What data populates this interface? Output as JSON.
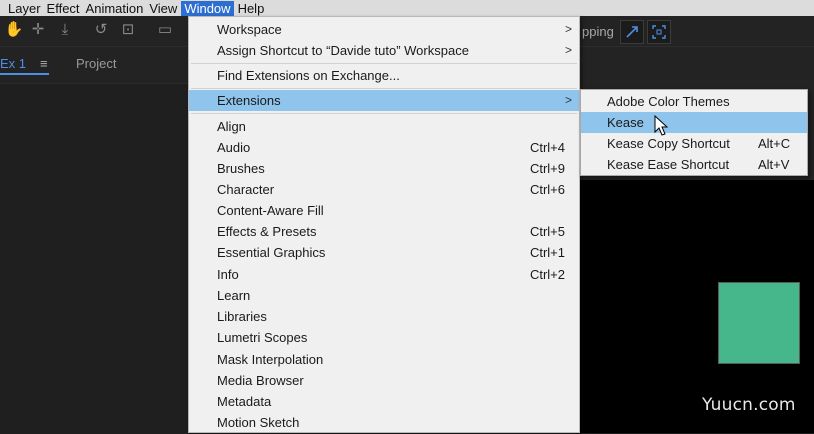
{
  "menubar": {
    "items": [
      "Layer",
      "Effect",
      "Animation",
      "View",
      "Window",
      "Help"
    ],
    "active_index": 4
  },
  "toolbar": {
    "snapping_label": "pping"
  },
  "panel": {
    "tabs": [
      "Ex 1",
      "Project"
    ],
    "menu_icon": "≡"
  },
  "window_menu": {
    "items": [
      {
        "label": "Workspace",
        "submenu": true
      },
      {
        "label": "Assign Shortcut to “Davide tuto” Workspace",
        "submenu": true
      },
      {
        "label": "Find Extensions on Exchange..."
      },
      {
        "label": "Extensions",
        "submenu": true,
        "highlighted": true
      },
      {
        "label": "Align"
      },
      {
        "label": "Audio",
        "shortcut": "Ctrl+4"
      },
      {
        "label": "Brushes",
        "shortcut": "Ctrl+9"
      },
      {
        "label": "Character",
        "shortcut": "Ctrl+6"
      },
      {
        "label": "Content-Aware Fill"
      },
      {
        "label": "Effects & Presets",
        "shortcut": "Ctrl+5"
      },
      {
        "label": "Essential Graphics",
        "shortcut": "Ctrl+1"
      },
      {
        "label": "Info",
        "shortcut": "Ctrl+2"
      },
      {
        "label": "Learn"
      },
      {
        "label": "Libraries"
      },
      {
        "label": "Lumetri Scopes"
      },
      {
        "label": "Mask Interpolation"
      },
      {
        "label": "Media Browser"
      },
      {
        "label": "Metadata"
      },
      {
        "label": "Motion Sketch"
      }
    ]
  },
  "extensions_submenu": {
    "items": [
      {
        "label": "Adobe Color Themes"
      },
      {
        "label": "Kease",
        "highlighted": true
      },
      {
        "label": "Kease Copy Shortcut",
        "shortcut": "Alt+C"
      },
      {
        "label": "Kease Ease Shortcut",
        "shortcut": "Alt+V"
      }
    ]
  },
  "watermark": "Yuucn.com",
  "colors": {
    "highlight": "#8fc4ec",
    "menubar_active": "#2c6fd1",
    "accent_blue": "#4e8fe6",
    "layer_square": "#46b78b"
  },
  "icons": [
    "hand-tool-icon",
    "anchor-point-icon",
    "pin-icon",
    "rotate-icon",
    "camera-orbit-icon",
    "rectangle-tool-icon",
    "snapping-icon",
    "expand-icon",
    "panel-menu-icon",
    "submenu-arrow-icon",
    "mouse-pointer-icon"
  ]
}
